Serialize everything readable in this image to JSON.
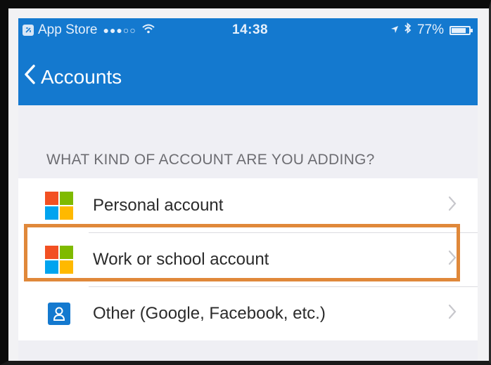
{
  "status_bar": {
    "carrier": "App Store",
    "signal": "●●●○○",
    "time": "14:38",
    "battery": "77%",
    "battery_level": 0.77
  },
  "nav": {
    "back_label": "Accounts"
  },
  "section": {
    "title": "WHAT KIND OF ACCOUNT ARE YOU ADDING?"
  },
  "accounts": [
    {
      "label": "Personal account",
      "icon": "microsoft-logo-icon"
    },
    {
      "label": "Work or school account",
      "icon": "microsoft-logo-icon",
      "highlighted": true
    },
    {
      "label": "Other (Google, Facebook, etc.)",
      "icon": "person-icon"
    }
  ],
  "colors": {
    "header": "#1479cf",
    "highlight": "#e0883a",
    "ms_red": "#f25022",
    "ms_green": "#7fba00",
    "ms_blue": "#00a4ef",
    "ms_yellow": "#ffb900"
  }
}
